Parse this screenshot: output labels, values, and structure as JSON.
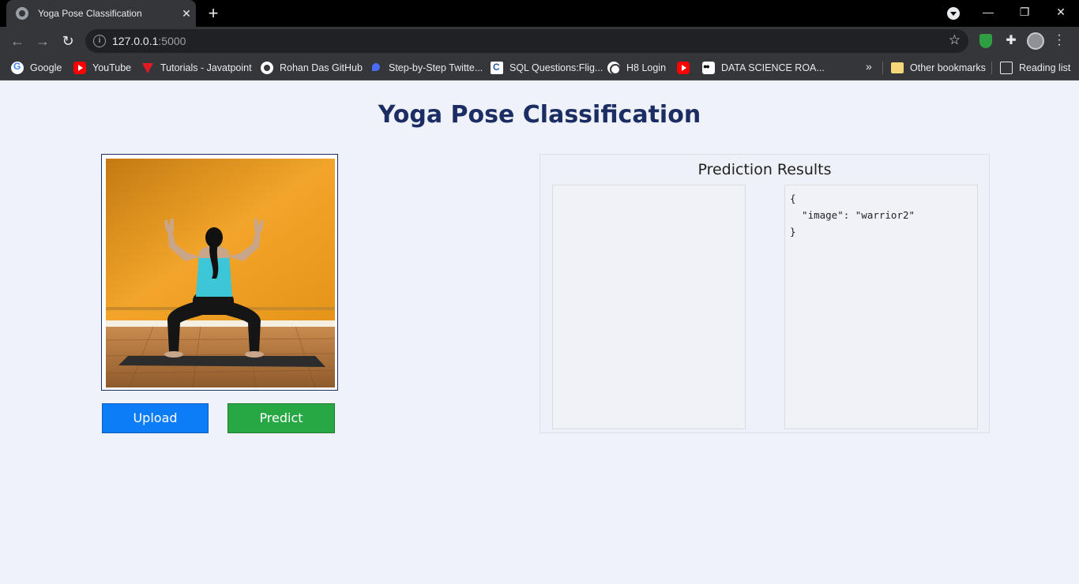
{
  "browser": {
    "tab_title": "Yoga Pose Classification",
    "tab_close": "✕",
    "new_tab": "+",
    "url_host": "127.0.0.1",
    "url_port": ":5000",
    "window_controls": {
      "minimize": "—",
      "restore": "❐",
      "close": "✕"
    },
    "bookmarks": [
      {
        "label": "Google",
        "icon": "google-icon"
      },
      {
        "label": "YouTube",
        "icon": "youtube-icon"
      },
      {
        "label": "Tutorials - Javatpoint",
        "icon": "javatpoint-icon"
      },
      {
        "label": "Rohan Das GitHub",
        "icon": "github-icon"
      },
      {
        "label": "Step-by-Step Twitte...",
        "icon": "twitter-step-icon"
      },
      {
        "label": "SQL Questions:Flig...",
        "icon": "sql-icon"
      },
      {
        "label": "H8 Login",
        "icon": "globe-icon"
      },
      {
        "label": "",
        "icon": "youtube-icon"
      },
      {
        "label": "DATA SCIENCE ROA...",
        "icon": "medium-icon"
      }
    ],
    "overflow": "»",
    "other_bookmarks": "Other bookmarks",
    "reading_list": "Reading list"
  },
  "page": {
    "title": "Yoga Pose Classification",
    "upload_label": "Upload",
    "predict_label": "Predict",
    "results_title": "Prediction Results",
    "json_output": "{\n  \"image\": \"warrior2\"\n}"
  }
}
